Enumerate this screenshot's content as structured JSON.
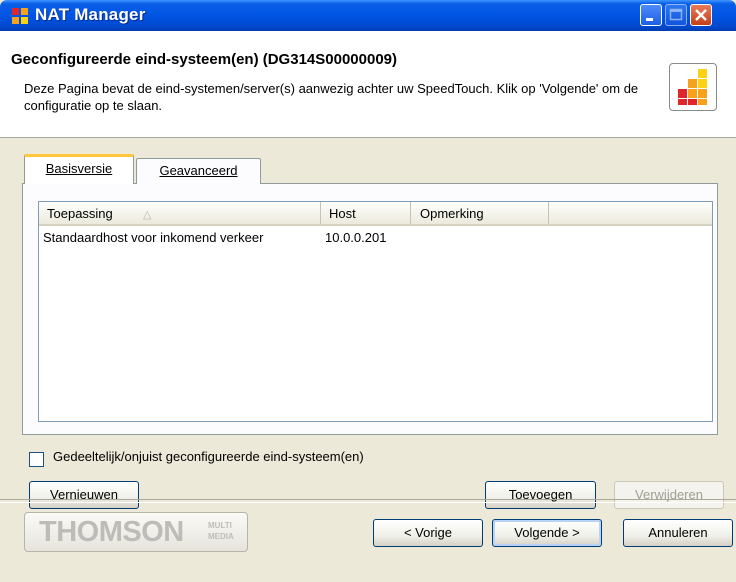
{
  "window": {
    "title": "NAT Manager"
  },
  "header": {
    "title": "Geconfigureerde eind-systeem(en) (DG314S00000009)",
    "description": "Deze Pagina bevat de eind-systemen/server(s) aanwezig achter uw SpeedTouch. Klik op 'Volgende' om de configuratie op te slaan."
  },
  "tabs": [
    {
      "label": "Basisversie",
      "selected": true
    },
    {
      "label": "Geavanceerd",
      "selected": false
    }
  ],
  "list": {
    "columns": [
      "Toepassing",
      "Host",
      "Opmerking"
    ],
    "sort_column": "Toepassing",
    "rows": [
      {
        "toepassing": "Standaardhost voor inkomend verkeer",
        "host": "10.0.0.201",
        "opmerking": ""
      }
    ]
  },
  "checkbox": {
    "label": "Gedeeltelijk/onjuist geconfigureerde eind-systeem(en)",
    "checked": false
  },
  "buttons": {
    "refresh": "Vernieuwen",
    "add": "Toevoegen",
    "remove": "Verwijderen",
    "back": "< Vorige",
    "next": "Volgende >",
    "cancel": "Annuleren"
  },
  "footer": {
    "brand": "THOMSON",
    "brand_sub": "MULTI MEDIA"
  },
  "colors": {
    "titlebar": "#0054e3",
    "dialog_bg": "#ece9d8",
    "logo_orange": "#f7a21b",
    "logo_red": "#e0262b",
    "logo_yellow": "#fcd214"
  },
  "icons": {
    "app": "nat-manager-app-icon",
    "header_logo": "speedtouch-logo-icon"
  }
}
